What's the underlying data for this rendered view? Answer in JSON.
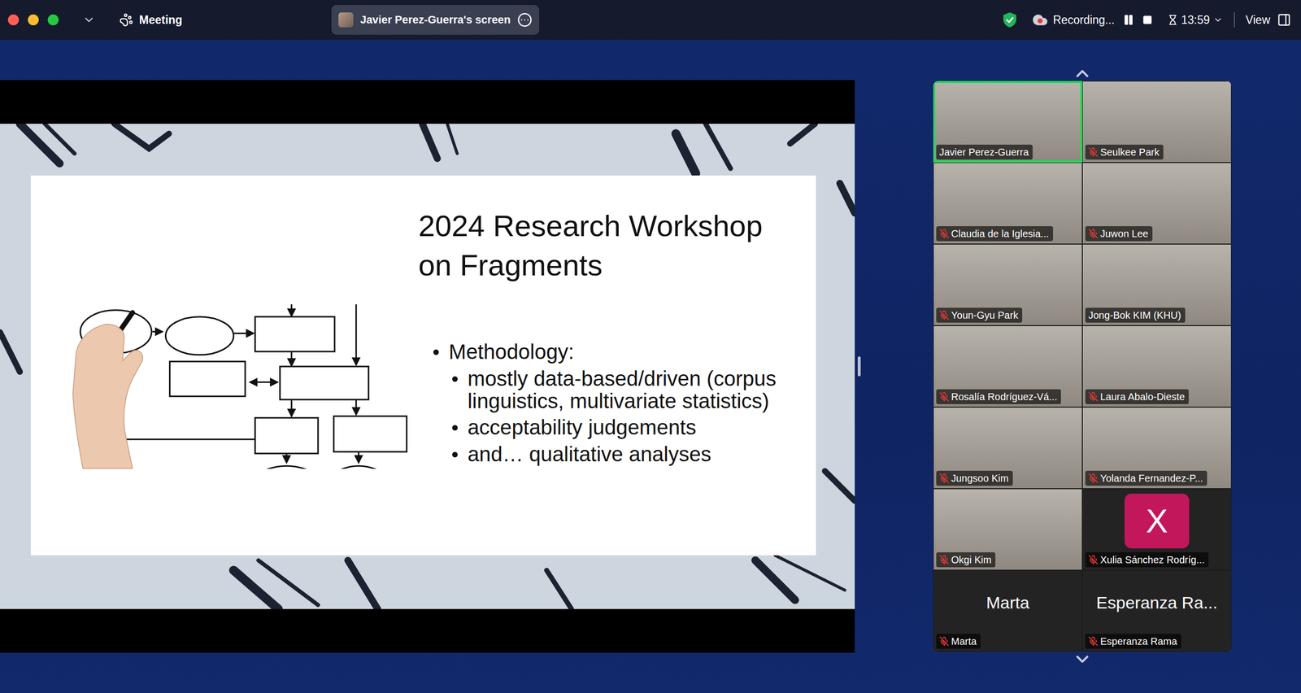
{
  "window": {
    "title": "Meeting"
  },
  "share_pill": {
    "label": "Javier Perez-Guerra's screen"
  },
  "status": {
    "recording": "Recording...",
    "timer": "13:59",
    "view": "View"
  },
  "slide": {
    "title_lines": [
      "2024 Research Workshop",
      "on Fragments"
    ],
    "bullets": [
      {
        "text": "Methodology:",
        "sub": [
          "mostly data-based/driven (corpus linguistics, multivariate statistics)",
          "acceptability judgements",
          "and… qualitative analyses"
        ]
      }
    ]
  },
  "participants": [
    {
      "name": "Javier Perez-Guerra",
      "muted": false,
      "speaking": true,
      "kind": "video"
    },
    {
      "name": "Seulkee Park",
      "muted": true,
      "speaking": false,
      "kind": "video"
    },
    {
      "name": "Claudia de la Iglesia...",
      "muted": true,
      "speaking": false,
      "kind": "video"
    },
    {
      "name": "Juwon Lee",
      "muted": true,
      "speaking": false,
      "kind": "video"
    },
    {
      "name": "Youn-Gyu Park",
      "muted": true,
      "speaking": false,
      "kind": "video"
    },
    {
      "name": "Jong-Bok KIM (KHU)",
      "muted": false,
      "speaking": false,
      "kind": "video"
    },
    {
      "name": "Rosalía Rodríguez-Vá...",
      "muted": true,
      "speaking": false,
      "kind": "video"
    },
    {
      "name": "Laura Abalo-Dieste",
      "muted": true,
      "speaking": false,
      "kind": "video"
    },
    {
      "name": "Jungsoo Kim",
      "muted": true,
      "speaking": false,
      "kind": "video"
    },
    {
      "name": "Yolanda Fernandez-P...",
      "muted": true,
      "speaking": false,
      "kind": "video"
    },
    {
      "name": "Okgi Kim",
      "muted": true,
      "speaking": false,
      "kind": "video"
    },
    {
      "name": "Xulia Sánchez Rodríg...",
      "muted": true,
      "speaking": false,
      "kind": "avatar",
      "initial": "X",
      "color": "#c2185b"
    },
    {
      "name": "Marta",
      "muted": true,
      "speaking": false,
      "kind": "name",
      "display": "Marta"
    },
    {
      "name": "Esperanza Rama",
      "muted": true,
      "speaking": false,
      "kind": "name",
      "display": "Esperanza Ra..."
    }
  ]
}
